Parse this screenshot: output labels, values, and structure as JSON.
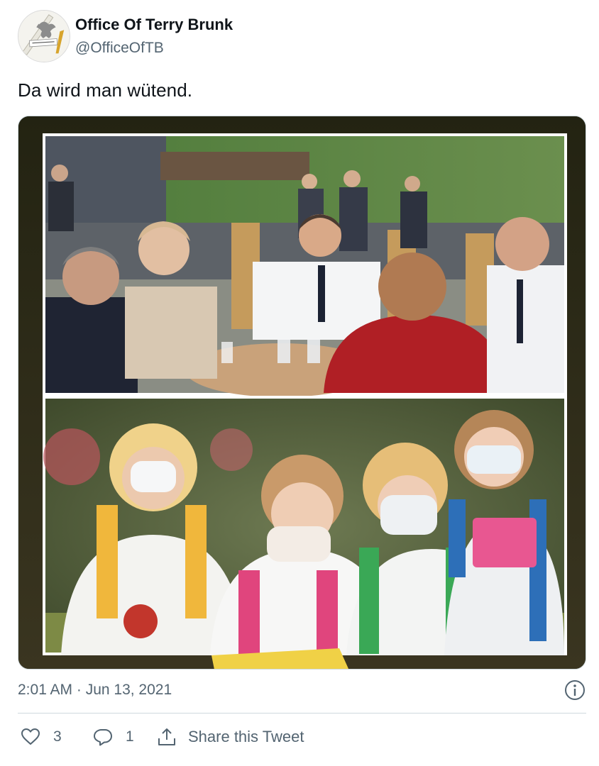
{
  "tweet": {
    "author": {
      "display_name": "Office Of Terry Brunk",
      "handle": "@OfficeOfTB",
      "avatar_icon": "eagle-seal-icon"
    },
    "text": "Da wird man wütend.",
    "media": {
      "panels": [
        "photo-top-adults-at-table",
        "photo-bottom-children-with-masks"
      ],
      "frame_color": "#2e2c16"
    },
    "timestamp": "2:01 AM · Jun 13, 2021",
    "actions": {
      "like": {
        "icon": "heart-icon",
        "count": "3"
      },
      "reply": {
        "icon": "reply-bubble-icon",
        "count": "1"
      },
      "share": {
        "icon": "share-icon",
        "label": "Share this Tweet"
      }
    },
    "info_icon": "info-icon"
  },
  "colors": {
    "text_primary": "#0f1419",
    "text_secondary": "#536471",
    "divider": "#cfd9de"
  }
}
